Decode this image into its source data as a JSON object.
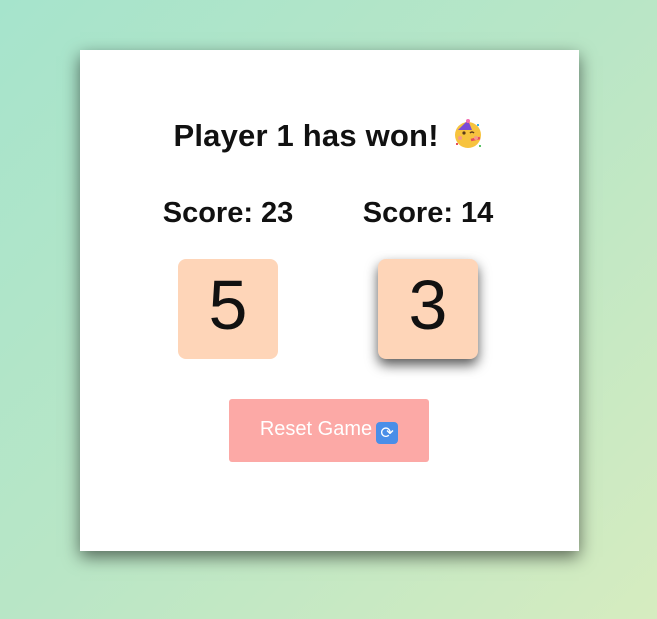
{
  "game": {
    "status_message": "Player 1 has won!",
    "status_emoji": "partying-face-icon"
  },
  "players": [
    {
      "score_label": "Score:",
      "score": "23",
      "die_value": "5",
      "active": false
    },
    {
      "score_label": "Score:",
      "score": "14",
      "die_value": "3",
      "active": true
    }
  ],
  "reset_button": {
    "label": "Reset Game",
    "icon": "repeat-icon"
  },
  "colors": {
    "die_face": "#fed5b8",
    "reset_button": "#fca9a6",
    "card": "#ffffff"
  }
}
